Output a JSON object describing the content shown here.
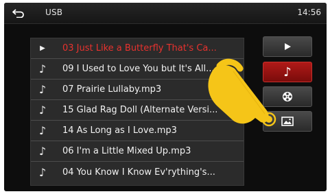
{
  "header": {
    "title": "USB",
    "clock": "14:56"
  },
  "tracks": [
    {
      "title": "03 Just Like a Butterfly That's Ca...",
      "icon": "play-icon",
      "active": true
    },
    {
      "title": "09 I Used to Love You but It's All...",
      "icon": "music-note-icon",
      "active": false
    },
    {
      "title": "07 Prairie Lullaby.mp3",
      "icon": "music-note-icon",
      "active": false
    },
    {
      "title": "15 Glad Rag Doll (Alternate Versi...",
      "icon": "music-note-icon",
      "active": false
    },
    {
      "title": "14 As Long as I Love.mp3",
      "icon": "music-note-icon",
      "active": false
    },
    {
      "title": "06 I'm a Little Mixed Up.mp3",
      "icon": "music-note-icon",
      "active": false
    },
    {
      "title": "04 You Know I Know Ev'rything's...",
      "icon": "music-note-icon",
      "active": false
    }
  ],
  "side_buttons": [
    {
      "name": "play",
      "icon": "play-icon",
      "active": false
    },
    {
      "name": "music",
      "icon": "music-note-icon",
      "active": true
    },
    {
      "name": "video",
      "icon": "film-reel-icon",
      "active": false
    },
    {
      "name": "photo",
      "icon": "picture-icon",
      "active": false
    }
  ],
  "colors": {
    "accent_red": "#e8322e",
    "active_button": "#b01a18",
    "background": "#0d0d0d",
    "pointer_hand": "#f5c518"
  }
}
